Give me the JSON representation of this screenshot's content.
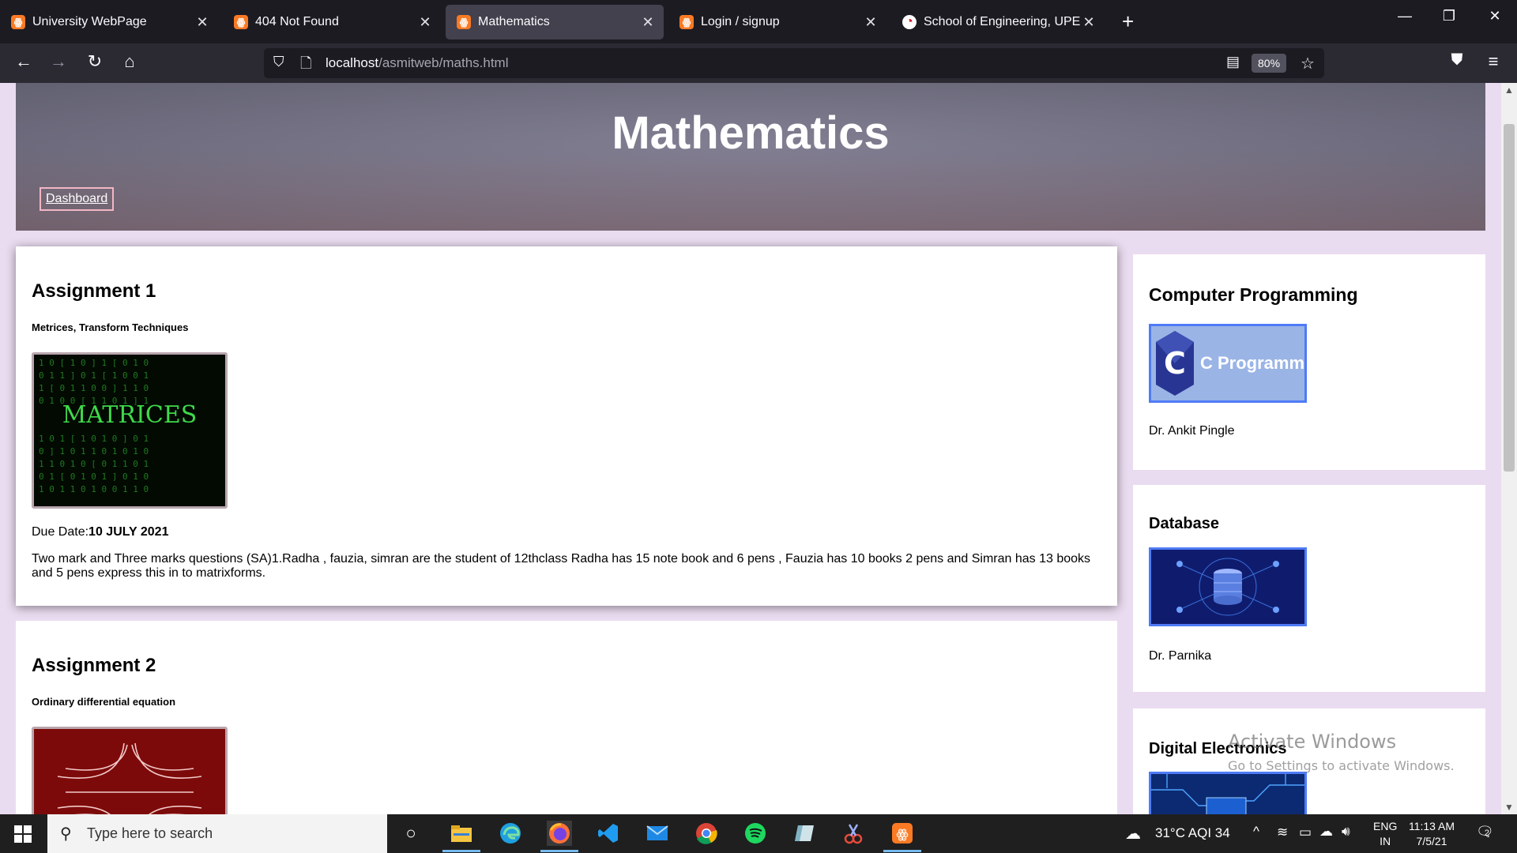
{
  "browser": {
    "tabs": [
      {
        "title": "University WebPage",
        "favicon": "xampp-icon",
        "active": false
      },
      {
        "title": "404 Not Found",
        "favicon": "xampp-icon",
        "active": false
      },
      {
        "title": "Mathematics",
        "favicon": "xampp-icon",
        "active": true
      },
      {
        "title": "Login / signup",
        "favicon": "xampp-icon",
        "active": false
      },
      {
        "title": "School of Engineering, UPES De",
        "favicon": "upes-icon",
        "active": false
      }
    ],
    "url_host": "localhost",
    "url_path": "/asmitweb/maths.html",
    "zoom": "80%"
  },
  "page": {
    "title": "Mathematics",
    "dashboard_link": "Dashboard",
    "assignments": [
      {
        "heading": "Assignment 1",
        "topic": "Metrices, Transform Techniques",
        "image_text": "MATRICES",
        "due_label": "Due Date:",
        "due_date": "10 JULY 2021",
        "description": "Two mark and Three marks questions (SA)1.Radha , fauzia, simran are the student of 12thclass Radha has 15 note book and 6 pens , Fauzia has 10 books 2 pens and Simran has 13 books and 5 pens express this in to matrixforms."
      },
      {
        "heading": "Assignment 2",
        "topic": "Ordinary differential equation"
      }
    ],
    "courses": [
      {
        "name": "Computer Programming",
        "image_text": "C Programming",
        "professor": "Dr. Ankit Pingle"
      },
      {
        "name": "Database",
        "professor": "Dr. Parnika"
      },
      {
        "name": "Digital Electronics"
      }
    ],
    "watermark_title": "Activate Windows",
    "watermark_sub": "Go to Settings to activate Windows."
  },
  "taskbar": {
    "search_placeholder": "Type here to search",
    "weather": "31°C  AQI 34",
    "lang_line1": "ENG",
    "lang_line2": "IN",
    "time": "11:13 AM",
    "date": "7/5/21",
    "notification_count": "2"
  }
}
